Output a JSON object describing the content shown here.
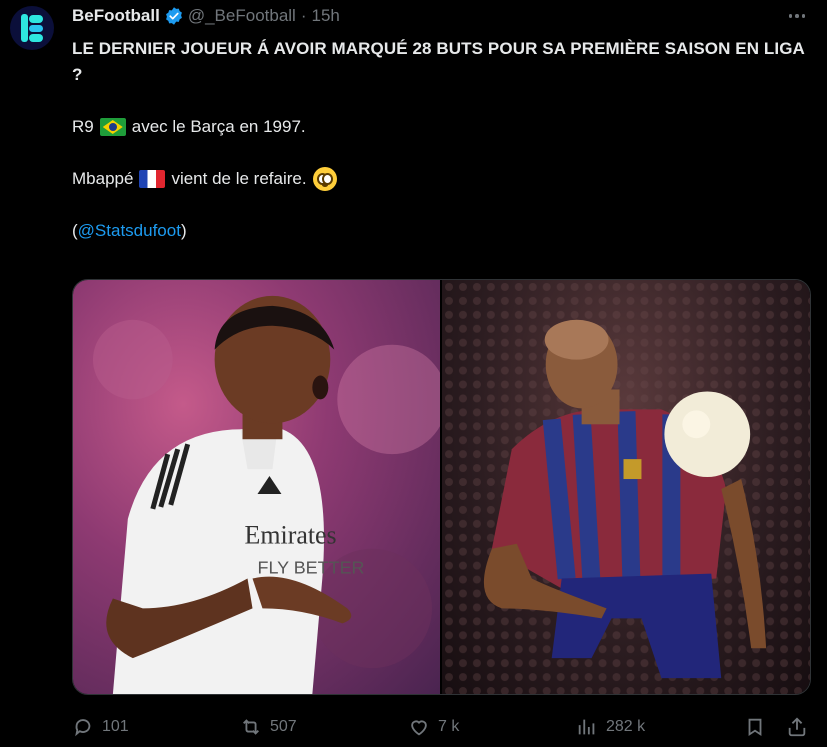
{
  "account": {
    "display_name": "BeFootball",
    "handle": "@_BeFootball",
    "separator": "·",
    "time": "15h",
    "verified": true,
    "avatar_icon": "befootball-logo-icon"
  },
  "tweet": {
    "headline": "LE DERNIER JOUEUR Á AVOIR MARQUÉ 28 BUTS POUR SA PREMIÈRE SAISON EN LIGA ?",
    "line1_a": "R9",
    "line1_b": "avec le Barça en 1997.",
    "line2_a": "Mbappé",
    "line2_b": "vient de le refaire.",
    "mention_open": "(",
    "mention": "@Statsdufoot",
    "mention_close": ")"
  },
  "media": {
    "left_photo": "mbappe-real-madrid-photo",
    "right_photo": "ronaldo-barcelona-photo"
  },
  "actions": {
    "replies": "101",
    "reposts": "507",
    "likes": "7 k",
    "views": "282 k"
  },
  "colors": {
    "background": "#000000",
    "text": "#e7e9ea",
    "muted": "#71767b",
    "link": "#1d9bf0",
    "verified": "#1d9bf0"
  }
}
